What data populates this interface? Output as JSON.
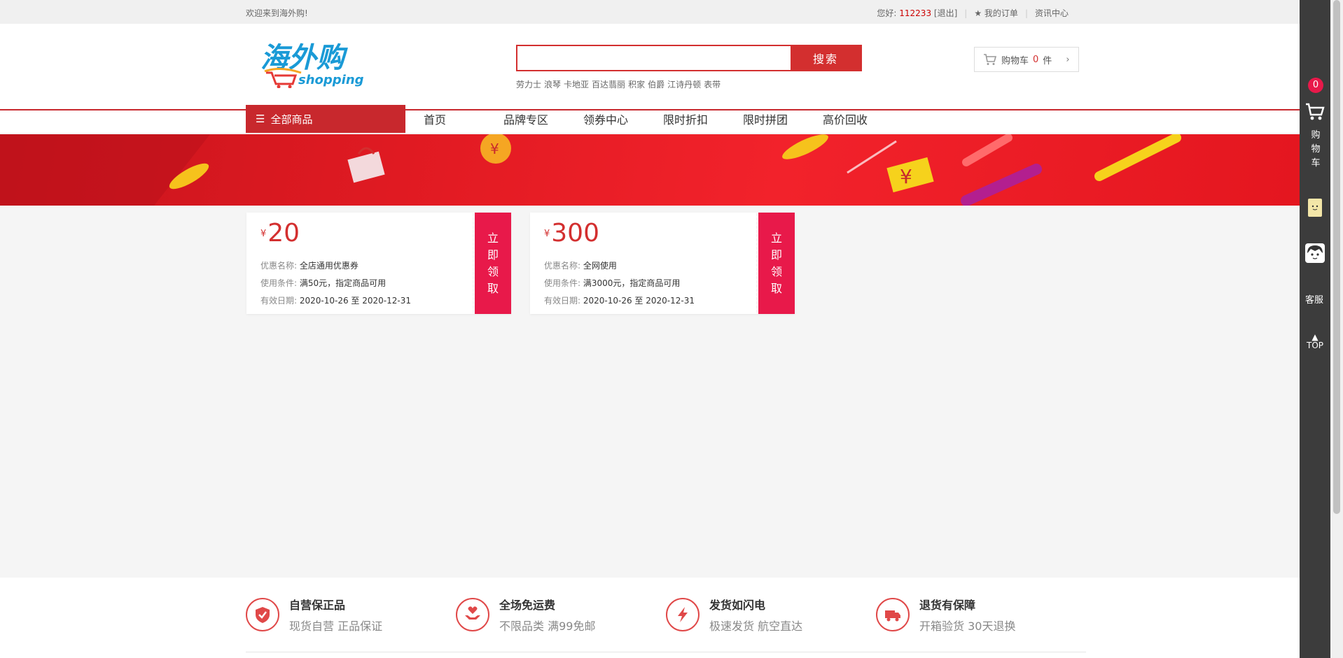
{
  "topbar": {
    "welcome": "欢迎来到海外购!",
    "greeting": "您好:",
    "username": "112233",
    "logout": "[退出]",
    "my_orders": "我的订单",
    "news_center": "资讯中心"
  },
  "header": {
    "logo_main": "海外购",
    "logo_sub": "shopping",
    "search_placeholder": "",
    "search_button": "搜索",
    "hot_keywords": [
      "劳力士",
      "浪琴",
      "卡地亚",
      "百达翡丽",
      "积家",
      "伯爵",
      "江诗丹顿",
      "表带"
    ],
    "cart_label": "购物车",
    "cart_count": "0",
    "cart_unit": "件"
  },
  "nav": {
    "all_categories": "全部商品",
    "items": [
      "首页",
      "品牌专区",
      "领券中心",
      "限时折扣",
      "限时拼团",
      "高价回收"
    ]
  },
  "coupons": [
    {
      "currency": "¥",
      "amount": "20",
      "name_label": "优惠名称:",
      "name": "全店通用优惠券",
      "condition_label": "使用条件:",
      "condition": "满50元，指定商品可用",
      "date_label": "有效日期:",
      "date": "2020-10-26 至 2020-12-31",
      "action": [
        "立",
        "即",
        "领",
        "取"
      ]
    },
    {
      "currency": "¥",
      "amount": "300",
      "name_label": "优惠名称:",
      "name": "全网使用",
      "condition_label": "使用条件:",
      "condition": "满3000元，指定商品可用",
      "date_label": "有效日期:",
      "date": "2020-10-26 至 2020-12-31",
      "action": [
        "立",
        "即",
        "领",
        "取"
      ]
    }
  ],
  "services": [
    {
      "title": "自营保正品",
      "desc": "现货自营 正品保证",
      "icon": "shield-check-icon"
    },
    {
      "title": "全场免运费",
      "desc": "不限品类 满99免邮",
      "icon": "hands-heart-icon"
    },
    {
      "title": "发货如闪电",
      "desc": "极速发货 航空直达",
      "icon": "lightning-icon"
    },
    {
      "title": "退货有保障",
      "desc": "开箱验货 30天退换",
      "icon": "truck-icon"
    }
  ],
  "sidebar": {
    "cart_badge": "0",
    "cart_text": [
      "购",
      "物",
      "车"
    ],
    "customer_service": "客服",
    "top": "TOP"
  },
  "colors": {
    "brand_red": "#c8282d",
    "accent_pink": "#e8194a",
    "sidebar_bg": "#3c3c3c"
  }
}
